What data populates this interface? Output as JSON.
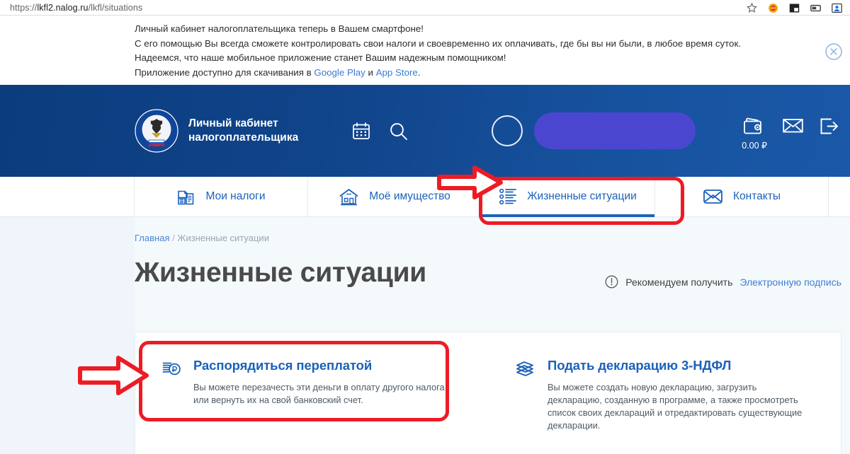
{
  "browser": {
    "url_prefix": "https://",
    "url_host": "lkfl2.nalog.ru",
    "url_path": "/lkfl/situations",
    "icons": [
      "bookmark-star-icon",
      "extension-icon",
      "picture-in-picture-icon",
      "cast-icon",
      "profile-icon"
    ]
  },
  "promo": {
    "line1": "Личный кабинет налогоплательщика теперь в Вашем смартфоне!",
    "line2": "С его помощью Вы всегда сможете контролировать свои налоги и своевременно их оплачивать, где бы вы ни были, в любое время суток.",
    "line3": "Надеемся, что наше мобильное приложение станет Вашим надежным помощником!",
    "line4_prefix": "Приложение доступно для скачивания в ",
    "link_google": "Google Play",
    "line4_mid": " и ",
    "link_appstore": "App Store",
    "line4_suffix": ".",
    "close_label": "×"
  },
  "header": {
    "logo_line1": "Личный кабинет",
    "logo_line2": "налогоплательщика",
    "emblem_name": "fns-emblem-icon",
    "calendar_icon": "calendar-icon",
    "search_icon": "search-icon",
    "avatar_name": "user-avatar",
    "user_name_redacted": "",
    "wallet_icon": "wallet-icon",
    "wallet_amount": "0.00 ₽",
    "mail_icon": "mail-icon",
    "logout_icon": "logout-icon"
  },
  "nav": {
    "items": [
      {
        "label": "Мои налоги",
        "icon": "documents-icon",
        "active": false
      },
      {
        "label": "Моё имущество",
        "icon": "house-icon",
        "active": false
      },
      {
        "label": "Жизненные ситуации",
        "icon": "list-icon",
        "active": true
      },
      {
        "label": "Контакты",
        "icon": "envelope-icon",
        "active": false
      }
    ]
  },
  "breadcrumb": {
    "home": "Главная",
    "separator": "/",
    "current": "Жизненные ситуации"
  },
  "page": {
    "title": "Жизненные ситуации",
    "esign_icon": "info-exclamation-icon",
    "esign_prefix": "Рекомендуем получить ",
    "esign_link": "Электронную подпись"
  },
  "cards": [
    {
      "icon": "ruble-money-icon",
      "title": "Распорядиться переплатой",
      "desc": "Вы можете перезачесть эти деньги в оплату другого налога или вернуть их на свой банковский счет."
    },
    {
      "icon": "declaration-stack-icon",
      "title": "Подать декларацию 3-НДФЛ",
      "desc": "Вы можете создать новую декларацию, загрузить декларацию, созданную в программе, а также просмотреть список своих деклараций и отредактировать существующие декларации."
    }
  ],
  "annotations": {
    "color": "#ed1c24",
    "arrow_to_tab": "red-arrow-right",
    "box_around_tab": "red-highlight-box",
    "arrow_to_card": "red-arrow-right",
    "box_around_card": "red-highlight-box"
  }
}
